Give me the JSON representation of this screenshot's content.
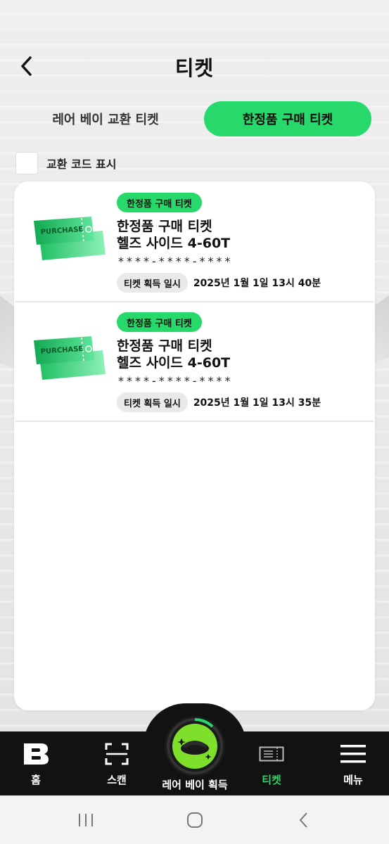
{
  "header": {
    "title": "티켓"
  },
  "tabs": [
    {
      "label": "레어 베이 교환 티켓",
      "active": false
    },
    {
      "label": "한정품 구매 티켓",
      "active": true
    }
  ],
  "toggle": {
    "label": "교환 코드 표시",
    "checked": false
  },
  "tickets": [
    {
      "badge": "한정품 구매 티켓",
      "title": "한정품 구매 티켓",
      "item": "헬즈 사이드 4-60T",
      "code": "****-****-****",
      "meta_label": "티켓 획득 일시",
      "date": "2025년 1월 1일 13시 40분",
      "image_text": "PURCHASE"
    },
    {
      "badge": "한정품 구매 티켓",
      "title": "한정품 구매 티켓",
      "item": "헬즈 사이드 4-60T",
      "code": "****-****-****",
      "meta_label": "티켓 획득 일시",
      "date": "2025년 1월 1일 13시 35분",
      "image_text": "PURCHASE"
    }
  ],
  "nav": {
    "home": "홈",
    "scan": "스캔",
    "center": "레어 베이 획득",
    "ticket": "티켓",
    "menu": "메뉴",
    "active": "ticket"
  },
  "colors": {
    "accent": "#27d86a",
    "nav_bg": "#121212",
    "card_bg": "#ffffff"
  },
  "icons": [
    "back-icon",
    "ticket-purchase-icon",
    "home-b-icon",
    "scan-icon",
    "rare-bay-icon",
    "ticket-icon",
    "menu-icon",
    "recent-apps-icon",
    "home-circle-icon",
    "system-back-icon"
  ]
}
